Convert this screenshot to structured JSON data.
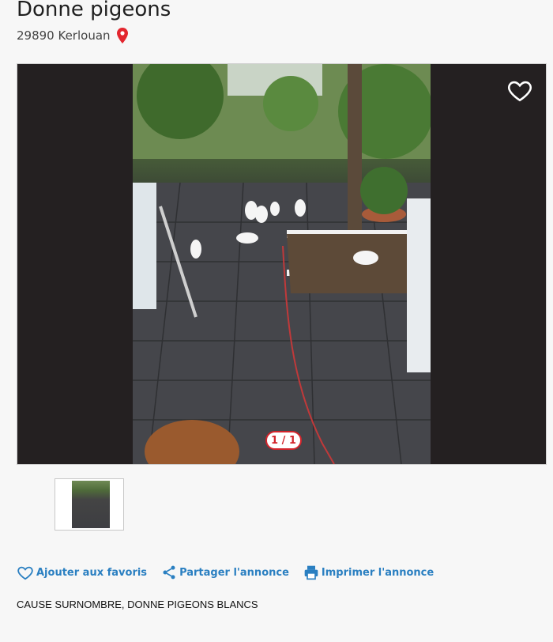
{
  "listing": {
    "title": "Donne pigeons",
    "location": "29890 Kerlouan"
  },
  "gallery": {
    "counter": "1 / 1"
  },
  "actions": {
    "favorite_label": "Ajouter aux favoris",
    "share_label": "Partager l'annonce",
    "print_label": "Imprimer l'annonce"
  },
  "description": "CAUSE SURNOMBRE, DONNE PIGEONS BLANCS",
  "colors": {
    "accent_blue": "#2a7fc1",
    "accent_red": "#d3242b",
    "gallery_bg": "#242021"
  },
  "icons": [
    "location-pin-icon",
    "heart-icon",
    "heart-outline-icon",
    "share-icon",
    "print-icon"
  ]
}
